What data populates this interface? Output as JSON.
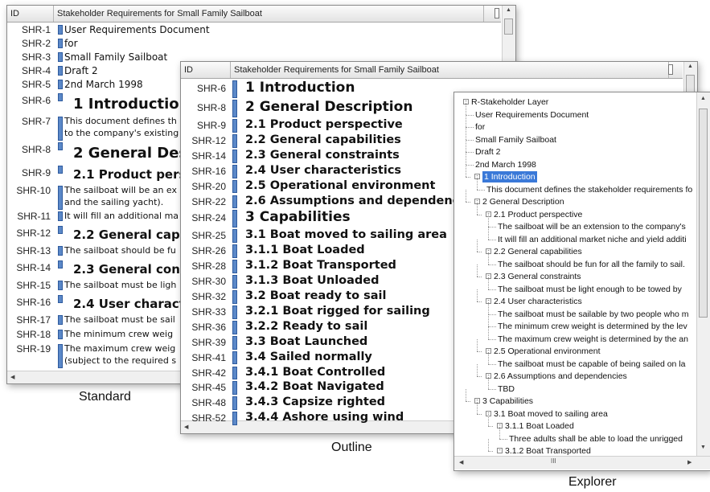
{
  "standard": {
    "id_header": "ID",
    "title_header": "Stakeholder Requirements for Small Family Sailboat",
    "caption": "Standard",
    "rows": [
      {
        "id": "SHR-1",
        "text": "User Requirements Document",
        "style": "normal"
      },
      {
        "id": "SHR-2",
        "text": "for",
        "style": "normal"
      },
      {
        "id": "SHR-3",
        "text": "Small Family Sailboat",
        "style": "normal"
      },
      {
        "id": "SHR-4",
        "text": "Draft 2",
        "style": "normal"
      },
      {
        "id": "SHR-5",
        "text": "2nd March 1998",
        "style": "normal"
      },
      {
        "id": "SHR-6",
        "text": "1 Introduction",
        "style": "h1"
      },
      {
        "id": "SHR-7",
        "text": "This document defines th",
        "text2": "to the company's existing",
        "style": "two"
      },
      {
        "id": "SHR-8",
        "text": "2 General Desc",
        "style": "h1"
      },
      {
        "id": "SHR-9",
        "text": "2.1 Product persp",
        "style": "h2"
      },
      {
        "id": "SHR-10",
        "text": "The sailboat will be an ex",
        "text2": "and the sailing yacht).",
        "style": "two"
      },
      {
        "id": "SHR-11",
        "text": "It will fill an additional ma",
        "style": "small"
      },
      {
        "id": "SHR-12",
        "text": "2.2 General capal",
        "style": "h2"
      },
      {
        "id": "SHR-13",
        "text": "The sailboat should be fu",
        "style": "small"
      },
      {
        "id": "SHR-14",
        "text": "2.3 General const",
        "style": "h2"
      },
      {
        "id": "SHR-15",
        "text": "The sailboat must be ligh",
        "style": "small"
      },
      {
        "id": "SHR-16",
        "text": "2.4 User characte",
        "style": "h2"
      },
      {
        "id": "SHR-17",
        "text": "The sailboat must be sail",
        "style": "small"
      },
      {
        "id": "SHR-18",
        "text": "The minimum crew weig",
        "style": "small"
      },
      {
        "id": "SHR-19",
        "text": "The maximum crew weig",
        "text2": "(subject to the required s",
        "style": "two"
      }
    ]
  },
  "outline": {
    "id_header": "ID",
    "title_header": "Stakeholder Requirements for Small Family Sailboat",
    "caption": "Outline",
    "rows": [
      {
        "id": "SHR-6",
        "text": "1 Introduction",
        "style": "big"
      },
      {
        "id": "SHR-8",
        "text": "2 General Description",
        "style": "big"
      },
      {
        "id": "SHR-9",
        "text": "2.1 Product perspective",
        "style": "mid"
      },
      {
        "id": "SHR-12",
        "text": "2.2 General capabilities",
        "style": "mid"
      },
      {
        "id": "SHR-14",
        "text": "2.3 General constraints",
        "style": "mid"
      },
      {
        "id": "SHR-16",
        "text": "2.4 User characteristics",
        "style": "mid"
      },
      {
        "id": "SHR-20",
        "text": "2.5 Operational environment",
        "style": "mid"
      },
      {
        "id": "SHR-22",
        "text": "2.6 Assumptions and dependencies",
        "style": "mid"
      },
      {
        "id": "SHR-24",
        "text": "3 Capabilities",
        "style": "big"
      },
      {
        "id": "SHR-25",
        "text": "3.1 Boat moved to sailing area",
        "style": "mid"
      },
      {
        "id": "SHR-26",
        "text": "3.1.1 Boat Loaded",
        "style": "mid"
      },
      {
        "id": "SHR-28",
        "text": "3.1.2 Boat Transported",
        "style": "mid"
      },
      {
        "id": "SHR-30",
        "text": "3.1.3 Boat Unloaded",
        "style": "mid"
      },
      {
        "id": "SHR-32",
        "text": "3.2 Boat ready to sail",
        "style": "mid"
      },
      {
        "id": "SHR-33",
        "text": "3.2.1 Boat rigged for sailing",
        "style": "mid"
      },
      {
        "id": "SHR-36",
        "text": "3.2.2 Ready to sail",
        "style": "mid"
      },
      {
        "id": "SHR-39",
        "text": "3.3 Boat Launched",
        "style": "mid"
      },
      {
        "id": "SHR-41",
        "text": "3.4 Sailed normally",
        "style": "mid"
      },
      {
        "id": "SHR-42",
        "text": "3.4.1 Boat Controlled",
        "style": "mid"
      },
      {
        "id": "SHR-45",
        "text": "3.4.2 Boat Navigated",
        "style": "mid"
      },
      {
        "id": "SHR-48",
        "text": "3.4.3 Capsize righted",
        "style": "mid"
      },
      {
        "id": "SHR-52",
        "text": "3.4.4 Ashore using wind",
        "style": "mid"
      }
    ]
  },
  "explorer": {
    "caption": "Explorer",
    "scroll_thumb": "III",
    "nodes": [
      {
        "text": "R-Stakeholder Layer",
        "level": 0,
        "toggle": "-"
      },
      {
        "text": "User Requirements Document",
        "level": 1,
        "toggle": ""
      },
      {
        "text": "for",
        "level": 1,
        "toggle": ""
      },
      {
        "text": "Small Family Sailboat",
        "level": 1,
        "toggle": ""
      },
      {
        "text": "Draft 2",
        "level": 1,
        "toggle": ""
      },
      {
        "text": "2nd March 1998",
        "level": 1,
        "toggle": ""
      },
      {
        "text": "1 Introduction",
        "level": 1,
        "toggle": "-",
        "selected": true
      },
      {
        "text": "This document defines the stakeholder requirements fo",
        "level": 2,
        "toggle": ""
      },
      {
        "text": "2 General Description",
        "level": 1,
        "toggle": "-"
      },
      {
        "text": "2.1 Product perspective",
        "level": 2,
        "toggle": "-"
      },
      {
        "text": "The sailboat will be an extension to the company's",
        "level": 3,
        "toggle": ""
      },
      {
        "text": "It will fill an additional market niche and yield additi",
        "level": 3,
        "toggle": ""
      },
      {
        "text": "2.2 General capabilities",
        "level": 2,
        "toggle": "-"
      },
      {
        "text": "The sailboat should be fun for all the family to sail.",
        "level": 3,
        "toggle": ""
      },
      {
        "text": "2.3 General constraints",
        "level": 2,
        "toggle": "-"
      },
      {
        "text": "The sailboat must be light enough to be towed by",
        "level": 3,
        "toggle": ""
      },
      {
        "text": "2.4 User characteristics",
        "level": 2,
        "toggle": "-"
      },
      {
        "text": "The sailboat must be sailable by two people who m",
        "level": 3,
        "toggle": ""
      },
      {
        "text": "The minimum crew weight is determined by the lev",
        "level": 3,
        "toggle": ""
      },
      {
        "text": "The maximum crew weight is determined by the an",
        "level": 3,
        "toggle": ""
      },
      {
        "text": "2.5 Operational environment",
        "level": 2,
        "toggle": "-"
      },
      {
        "text": "The sailboat must be capable of being sailed on la",
        "level": 3,
        "toggle": ""
      },
      {
        "text": "2.6 Assumptions and dependencies",
        "level": 2,
        "toggle": "-"
      },
      {
        "text": "TBD",
        "level": 3,
        "toggle": ""
      },
      {
        "text": "3 Capabilities",
        "level": 1,
        "toggle": "-"
      },
      {
        "text": "3.1 Boat moved to sailing area",
        "level": 2,
        "toggle": "-"
      },
      {
        "text": "3.1.1 Boat Loaded",
        "level": 3,
        "toggle": "-"
      },
      {
        "text": "Three adults shall be able to load the unrigged",
        "level": 4,
        "toggle": ""
      },
      {
        "text": "3.1.2 Boat Transported",
        "level": 3,
        "toggle": "-"
      }
    ]
  }
}
